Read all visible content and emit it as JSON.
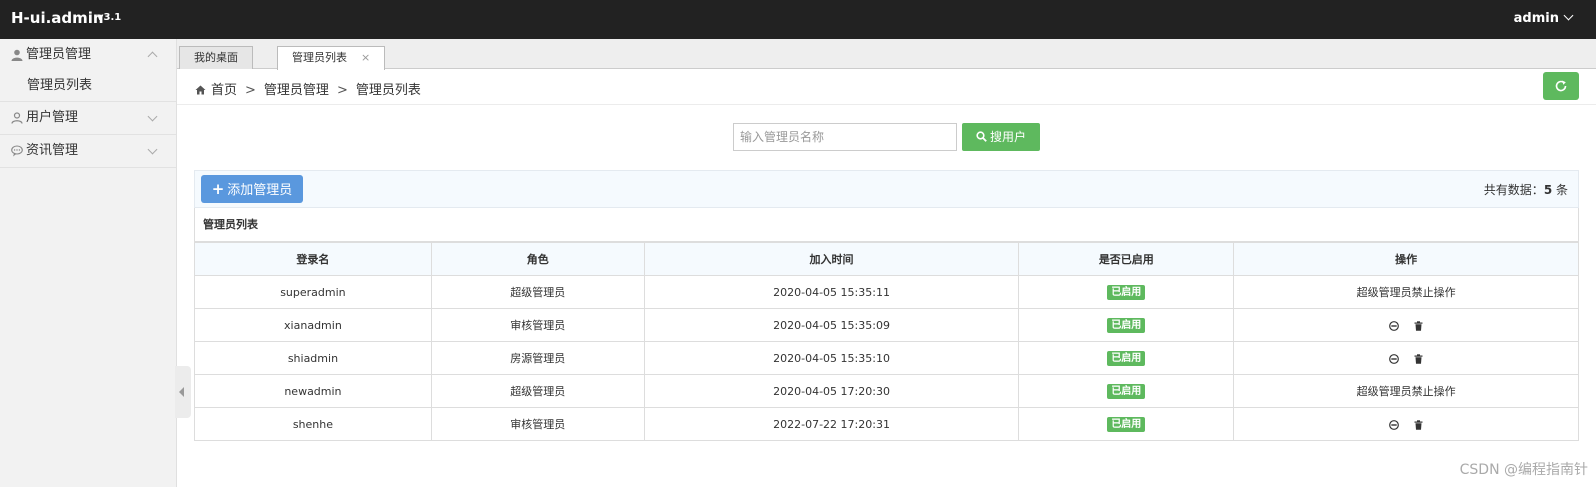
{
  "topbar": {
    "brand": "H-ui.admin",
    "version": "v3.1",
    "user": "admin"
  },
  "sidebar": {
    "groups": [
      {
        "label": "管理员管理",
        "icon": "user-icon",
        "expanded": true,
        "items": [
          "管理员列表"
        ]
      },
      {
        "label": "用户管理",
        "icon": "user-outline-icon",
        "expanded": false,
        "items": []
      },
      {
        "label": "资讯管理",
        "icon": "comment-icon",
        "expanded": false,
        "items": []
      }
    ]
  },
  "tabs": [
    {
      "label": "我的桌面",
      "active": false
    },
    {
      "label": "管理员列表",
      "active": true,
      "close": "×"
    }
  ],
  "breadcrumb": {
    "items": [
      "首页",
      "管理员管理",
      "管理员列表"
    ],
    "separator": ">"
  },
  "search": {
    "placeholder": "输入管理员名称",
    "button_label": "搜用户"
  },
  "toolbar": {
    "add_label": "添加管理员",
    "total_prefix": "共有数据：",
    "total_count": "5",
    "total_suffix": " 条"
  },
  "table": {
    "caption": "管理员列表",
    "headers": [
      "登录名",
      "角色",
      "加入时间",
      "是否已启用",
      "操作"
    ],
    "rows": [
      {
        "login": "superadmin",
        "role": "超级管理员",
        "joined": "2020-04-05 15:35:11",
        "status": "已启用",
        "action_text": "超级管理员禁止操作"
      },
      {
        "login": "xianadmin",
        "role": "审核管理员",
        "joined": "2020-04-05 15:35:09",
        "status": "已启用",
        "action_text": ""
      },
      {
        "login": "shiadmin",
        "role": "房源管理员",
        "joined": "2020-04-05 15:35:10",
        "status": "已启用",
        "action_text": ""
      },
      {
        "login": "newadmin",
        "role": "超级管理员",
        "joined": "2020-04-05 17:20:30",
        "status": "已启用",
        "action_text": "超级管理员禁止操作"
      },
      {
        "login": "shenhe",
        "role": "审核管理员",
        "joined": "2022-07-22 17:20:31",
        "status": "已启用",
        "action_text": ""
      }
    ]
  },
  "watermark": "CSDN @编程指南针",
  "colors": {
    "topbar_bg": "#222222",
    "success_green": "#5eb95e",
    "primary_blue": "#5a98de",
    "sidebar_bg": "#f2f2f2"
  }
}
